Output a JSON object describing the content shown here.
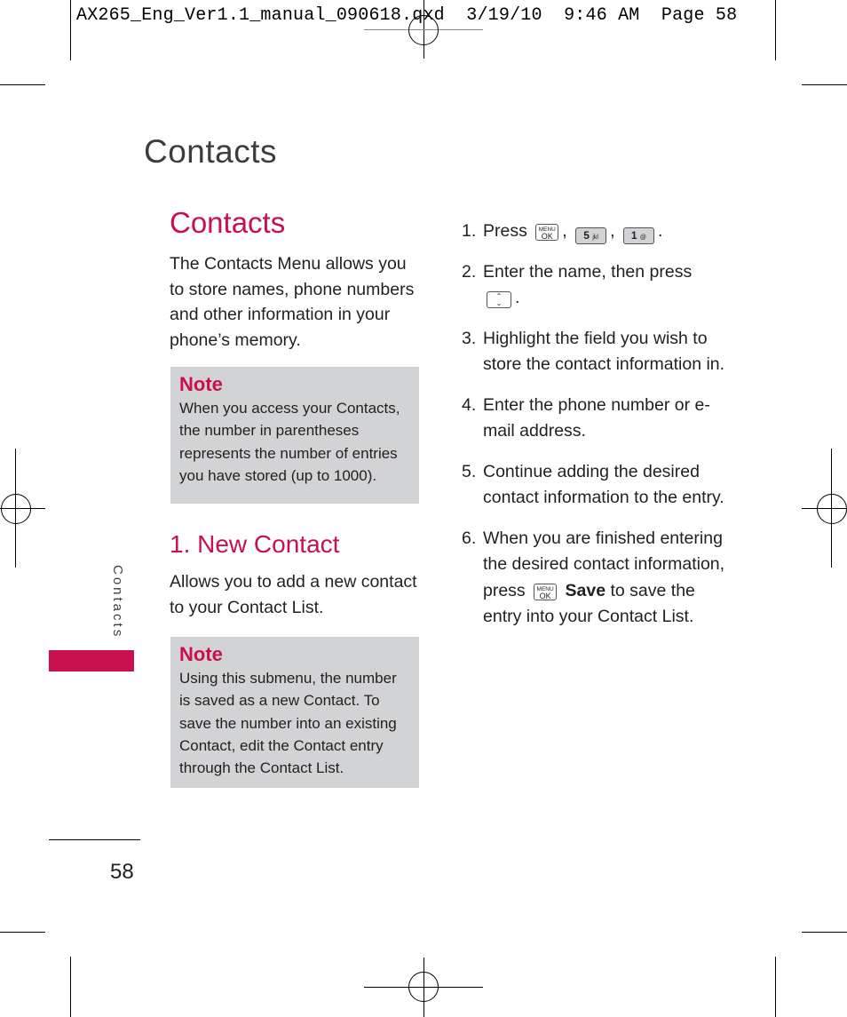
{
  "print_header": {
    "text": "AX265_Eng_Ver1.1_manual_090618.qxd  3/19/10  9:46 AM  Page 58"
  },
  "page": {
    "running_title": "Contacts",
    "side_tab": "Contacts",
    "page_number": "58",
    "accent_color": "#c8104f",
    "note_bg_color": "#d2d3d4"
  },
  "section": {
    "title": "Contacts",
    "intro": "The Contacts Menu allows you to store names, phone numbers and other information in your phone’s memory.",
    "note": {
      "title": "Note",
      "text": "When you access your Contacts, the number in parentheses represents the number of entries you have stored (up to 1000)."
    }
  },
  "subsection": {
    "title": "1. New Contact",
    "intro": "Allows you to add a new contact to your Contact List.",
    "note": {
      "title": "Note",
      "text": "Using this submenu, the number is saved as a new Contact. To save the number into an existing Contact, edit the Contact entry through the Contact List."
    }
  },
  "keys": {
    "menu_top": "MENU",
    "menu_bottom": "OK",
    "five_main": "5",
    "five_sub": "jkl",
    "one_main": "1",
    "one_sub": "@",
    "nav_up": "⌃",
    "nav_down": "⌄"
  },
  "steps": [
    {
      "num": "1.",
      "prefix": "Press",
      "sep1": ",",
      "sep2": ",",
      "suffix": "."
    },
    {
      "num": "2.",
      "text": "Enter the name, then press",
      "suffix": "."
    },
    {
      "num": "3.",
      "text": "Highlight the field you wish to store the contact information in."
    },
    {
      "num": "4.",
      "text": "Enter the phone number or e-mail address."
    },
    {
      "num": "5.",
      "text": "Continue adding the desired contact information to the entry."
    },
    {
      "num": "6.",
      "text_before": "When you are finished entering the desired contact information, press",
      "save_label": "Save",
      "text_after": "to save the entry into your Contact List."
    }
  ]
}
